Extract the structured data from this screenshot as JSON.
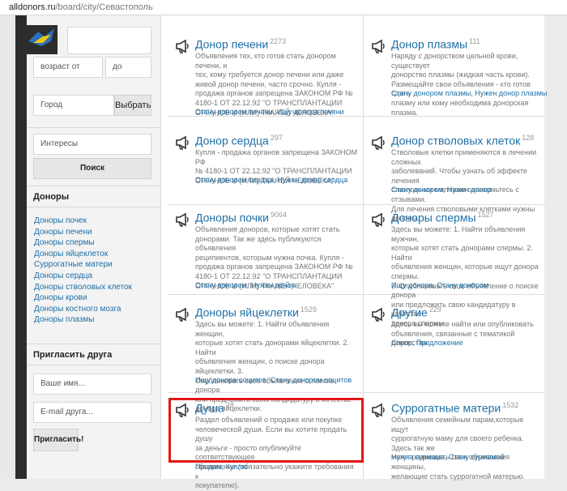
{
  "browser": {
    "url_host": "alldonors.ru",
    "url_path": "/board/city/Севастополь"
  },
  "sidebar": {
    "age_from_placeholder": "возраст от",
    "age_to_placeholder": "до",
    "city_placeholder": "Город",
    "city_button": "Выбрать",
    "interests_placeholder": "Интересы",
    "search_button": "Поиск",
    "donors_title": "Доноры",
    "donor_links": [
      "Доноры почек",
      "Доноры печени",
      "Доноры спермы",
      "Доноры яйцеклеток",
      "Суррогатные матери",
      "Доноры сердца",
      "Доноры стволовых клеток",
      "Доноры крови",
      "Доноры костного мозга",
      "Доноры плазмы"
    ],
    "invite_title": "Пригласить друга",
    "name_placeholder": "Ваше имя...",
    "email_placeholder": "E-mail друга...",
    "invite_button": "Пригласить!"
  },
  "categories": [
    {
      "title": "Донор печени",
      "count": "2273",
      "desc": [
        "Объявления тех, кто готов стать донором печени, и",
        "тех, кому требуется донор печени или даже",
        "живой донор печени, часто срочно. Купля -",
        "продажа органов запрещена ЗАКОНОМ РФ №",
        "4180-1 ОТ 22.12.92 \"О ТРАНСПЛАНТАЦИИ",
        "ОРГАНОВ И (ИЛИ) ТКАНЕЙ ЧЕЛОВЕКА\""
      ],
      "tags": "Стану донором печени, Ищу донора печени"
    },
    {
      "title": "Донор плазмы",
      "count": "111",
      "desc": [
        "Наряду с донорством цельной крови, существует",
        "донорство плазмы (жидкая часть крови).",
        "Размещайте свои объявления - кто готов сдать",
        "плазму или кому необходима донорская плазма."
      ],
      "tags": "Стану донором плазмы, Нужен донор плазмы"
    },
    {
      "title": "Донор сердца",
      "count": "297",
      "desc": [
        "Купля - продажа органов запрещена ЗАКОНОМ РФ",
        "№ 4180-1 ОТ 22.12.92 \"О ТРАНСПЛАНТАЦИИ",
        "ОРГАНОВ И (ИЛИ) ТКАНЕЙ ЧЕЛОВЕКА\""
      ],
      "tags": "Стану донором сердца, Нужен донор сердца"
    },
    {
      "title": "Донор стволовых клеток",
      "count": "128",
      "desc": [
        "Стволовые клетки применяются в лечении сложных",
        "заболеваний. Чтобы узнать об эффекте лечения",
        "стволовыми клетками ознакомьтесь с отзывами.",
        "Для лечения стволовыми клетками нужны доноры."
      ],
      "tags": "Стану донором, Нужен донор"
    },
    {
      "title": "Доноры почки",
      "count": "9064",
      "desc": [
        "Объявления доноров, которые хотят стать",
        "донорами. Так же здесь публикуются объявления",
        "реципиентов, которым нужна почка. Купля -",
        "продажа органов запрещена ЗАКОНОМ РФ №",
        "4180-1 ОТ 22.12.92 \"О ТРАНСПЛАНТАЦИИ",
        "ОРГАНОВ И (ИЛИ) ТКАНЕЙ ЧЕЛОВЕКА\""
      ],
      "tags": "Стану донором, Нужен донор"
    },
    {
      "title": "Доноры спермы",
      "count": "1527",
      "desc": [
        "Здесь вы можете: 1. Найти объявления мужчин,",
        "которые хотят стать донорами спермы. 2. Найти",
        "объявления женщин, которые ищут донора спермы.",
        "3. Опубликовать свое объявление о поиске донора",
        "или предложить свою кандидатуру в качестве",
        "донора спермы."
      ],
      "tags": "Ищу донора, Стану донором"
    },
    {
      "title": "Доноры яйцеклетки",
      "count": "1529",
      "desc": [
        "Здесь вы можете: 1. Найти объявления женщин,",
        "которые хотят стать донорами яйцеклетки. 2. Найти",
        "объявления женщин, о поиске донора яйцеклетки. 3.",
        "Опубликовать свое объявление о поиске донора",
        "или предложить свою кандидатуру в качестве",
        "донора яйцеклетки."
      ],
      "tags": "Ищу донора ооцитов, Стану донором ооцитов"
    },
    {
      "title": "Другие",
      "count": "229",
      "desc": [
        "Здесь вы можете найти или опубликовать",
        "объявления, связанные с тематикой донорства."
      ],
      "tags": "Спрос, Предложение"
    },
    {
      "title": "Душа",
      "count": "28",
      "desc": [
        "Раздел объявлений о продаже или покупке",
        "человеческой души. Если вы хотите продать душу",
        "за деньги - просто опубликуйте соответствующее",
        "объявление (обязательно укажите требования к",
        "покупателю)."
      ],
      "tags": "Продам, Куплю"
    },
    {
      "title": "Суррогатные матери",
      "count": "1532",
      "desc": [
        "Объявления семейным парам,которые ищут",
        "суррогатную маму для своего ребенка. Здесь так же",
        "могут размещать свои объявления женщины,",
        "желающие стать суррогатной матерью."
      ],
      "tags": "Нужна сурмама, Стану сурмамой"
    }
  ]
}
